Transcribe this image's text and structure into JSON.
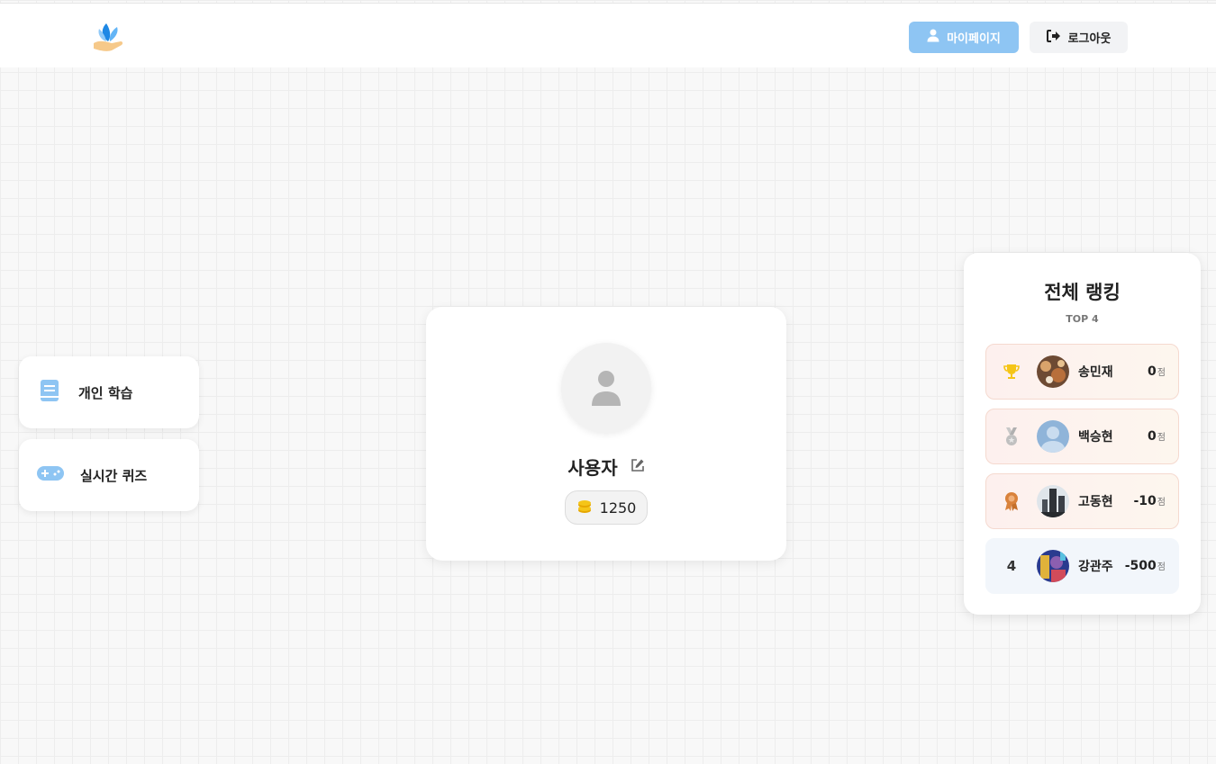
{
  "header": {
    "logo_icon": "leaf-hand-logo",
    "mypage_label": "마이페이지",
    "logout_label": "로그아웃"
  },
  "side_menu": [
    {
      "label": "개인 학습",
      "icon": "book-icon"
    },
    {
      "label": "실시간 퀴즈",
      "icon": "gamepad-icon"
    }
  ],
  "profile": {
    "name": "사용자",
    "coins": "1250"
  },
  "ranking": {
    "title": "전체 랭킹",
    "subtitle": "TOP 4",
    "unit": "점",
    "entries": [
      {
        "rank_icon": "trophy-icon",
        "name": "송민재",
        "score": "0"
      },
      {
        "rank_icon": "silver-medal-icon",
        "name": "백승현",
        "score": "0"
      },
      {
        "rank_icon": "bronze-award-icon",
        "name": "고동현",
        "score": "-10"
      },
      {
        "rank": "4",
        "name": "강관주",
        "score": "-500"
      }
    ]
  },
  "colors": {
    "primary": "#8ec5f3",
    "gold": "#f5c518",
    "bronze": "#d9823b"
  }
}
